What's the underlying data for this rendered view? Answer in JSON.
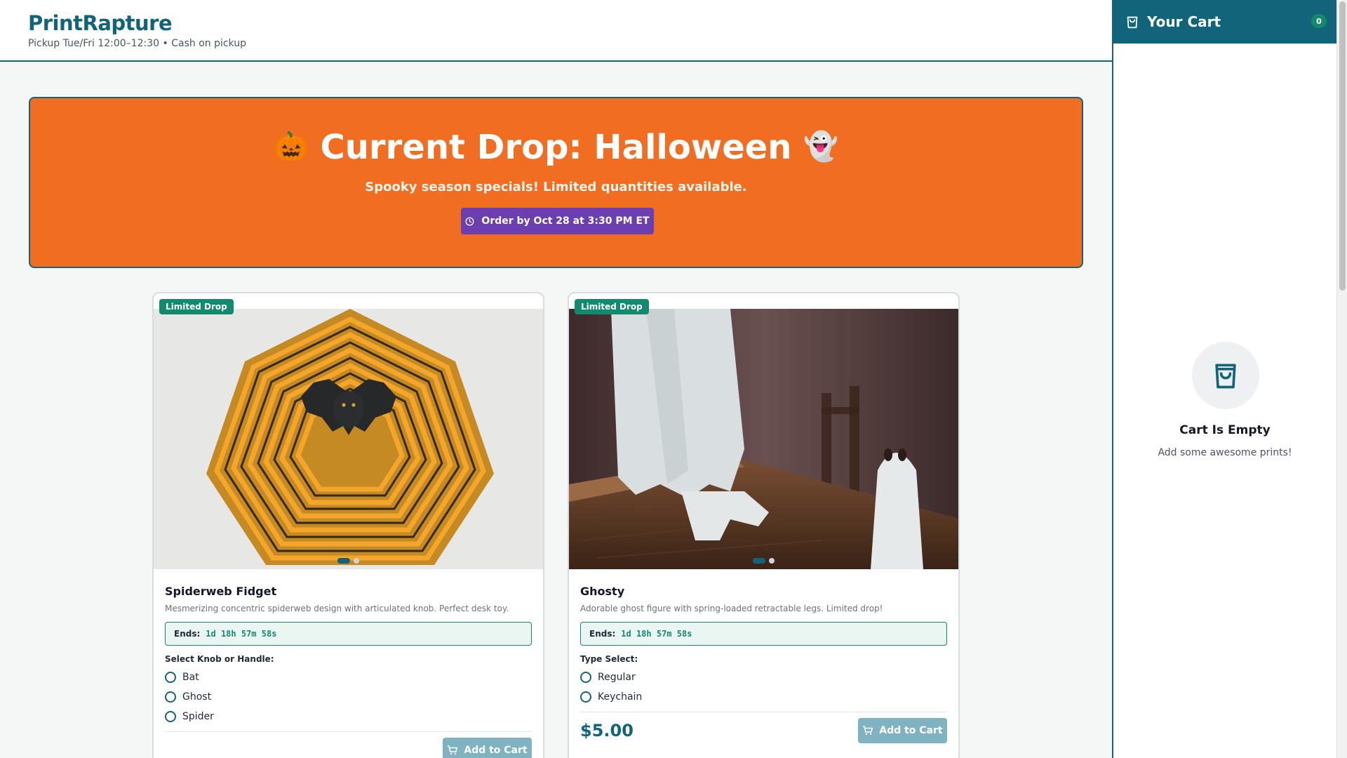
{
  "header": {
    "brand": "PrintRapture",
    "subtitle": "Pickup Tue/Fri 12:00–12:30 • Cash on pickup"
  },
  "banner": {
    "emoji_left": "🎃",
    "title": "Current Drop: Halloween",
    "emoji_right": "👻",
    "subtitle": "Spooky season specials! Limited quantities available.",
    "deadline": "Order by Oct 28 at 3:30 PM ET",
    "deadline_icon": "clock-icon",
    "color": "#f06d22",
    "button_color": "#6b3fb0"
  },
  "products": [
    {
      "badge": "Limited Drop",
      "title": "Spiderweb Fidget",
      "description": "Mesmerizing concentric spiderweb design with articulated knob. Perfect desk toy.",
      "ends_label": "Ends:",
      "ends_time": "1d 18h 57m 58s",
      "option_label": "Select Knob or Handle:",
      "options": [
        "Bat",
        "Ghost",
        "Spider"
      ],
      "price": "",
      "button": "Add to Cart",
      "image_count": 2,
      "active_image": 1
    },
    {
      "badge": "Limited Drop",
      "title": "Ghosty",
      "description": "Adorable ghost figure with spring-loaded retractable legs. Limited drop!",
      "ends_label": "Ends:",
      "ends_time": "1d 18h 57m 58s",
      "option_label": "Type Select:",
      "options": [
        "Regular",
        "Keychain"
      ],
      "price": "$5.00",
      "button": "Add to Cart",
      "image_count": 2,
      "active_image": 1
    }
  ],
  "cart": {
    "title": "Your Cart",
    "count": "0",
    "empty_title": "Cart Is Empty",
    "empty_sub": "Add some awesome prints!",
    "icon": "shopping-bag-icon"
  },
  "colors": {
    "primary": "#11647a",
    "accent": "#138a6e",
    "banner": "#f06d22"
  }
}
